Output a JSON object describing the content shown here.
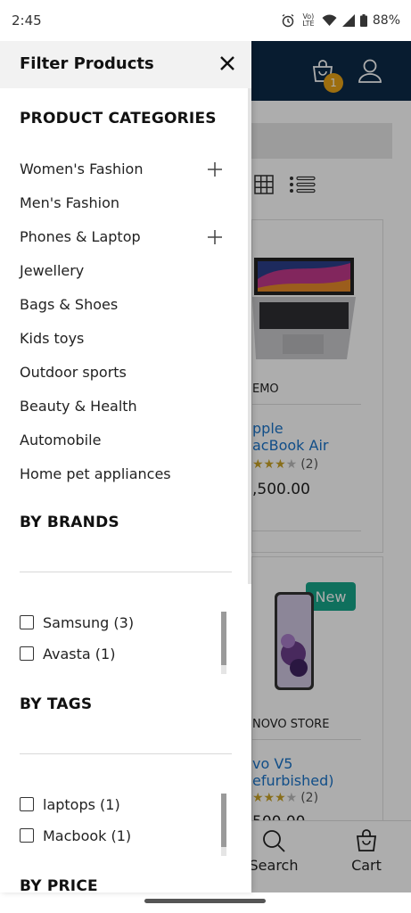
{
  "status_bar": {
    "time": "2:45",
    "network_label": "Vo) LTE",
    "battery": "88%"
  },
  "background": {
    "cart_badge": "1",
    "products": [
      {
        "vendor": "EMO",
        "name_line1": "pple",
        "name_line2": "acBook Air",
        "rating_count": "(2)",
        "price": ",500.00"
      },
      {
        "badge": "New",
        "vendor": "NOVO STORE",
        "name_line1": "vo V5",
        "name_line2": "efurbished)",
        "rating_count": "(2)",
        "price": "500.00"
      }
    ],
    "nav": {
      "search_label": "Search",
      "cart_label": "Cart"
    }
  },
  "drawer": {
    "title": "Filter Products",
    "categories_title": "PRODUCT CATEGORIES",
    "categories": [
      {
        "label": "Women's Fashion",
        "expandable": true
      },
      {
        "label": "Men's Fashion",
        "expandable": false
      },
      {
        "label": "Phones & Laptop",
        "expandable": true
      },
      {
        "label": "Jewellery",
        "expandable": false
      },
      {
        "label": "Bags & Shoes",
        "expandable": false
      },
      {
        "label": "Kids toys",
        "expandable": false
      },
      {
        "label": "Outdoor sports",
        "expandable": false
      },
      {
        "label": "Beauty & Health",
        "expandable": false
      },
      {
        "label": "Automobile",
        "expandable": false
      },
      {
        "label": "Home pet appliances",
        "expandable": false
      }
    ],
    "brands_title": "BY BRANDS",
    "brands": [
      {
        "label": "Samsung (3)",
        "checked": false
      },
      {
        "label": "Avasta (1)",
        "checked": false
      }
    ],
    "tags_title": "BY TAGS",
    "tags": [
      {
        "label": "laptops (1)",
        "checked": false
      },
      {
        "label": "Macbook (1)",
        "checked": false
      }
    ],
    "price_title": "BY PRICE"
  },
  "colors": {
    "header_bg": "#0c2a47",
    "badge": "#e8a317",
    "new_badge": "#17a589",
    "link": "#1a73c9"
  }
}
